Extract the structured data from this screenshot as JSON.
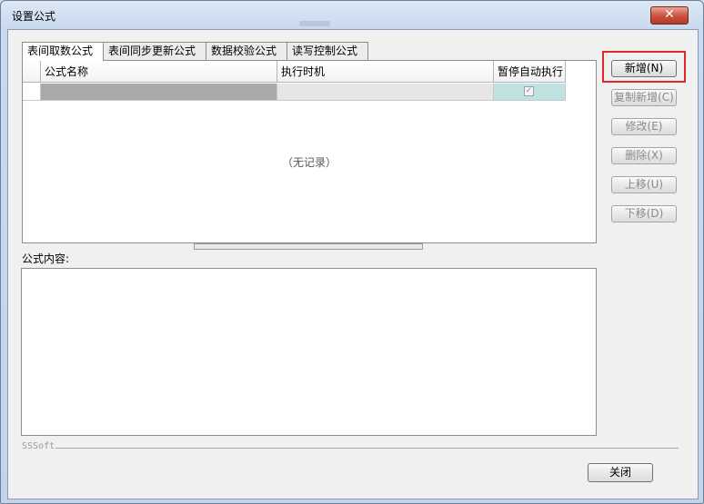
{
  "window": {
    "title": "设置公式",
    "close_glyph": "✕"
  },
  "tabs": [
    {
      "label": "表间取数公式",
      "active": true
    },
    {
      "label": "表间同步更新公式",
      "active": false
    },
    {
      "label": "数据校验公式",
      "active": false
    },
    {
      "label": "读写控制公式",
      "active": false
    }
  ],
  "grid": {
    "columns": [
      "公式名称",
      "执行时机",
      "暂停自动执行"
    ],
    "row": {
      "checkbox_checked": true,
      "checkbox_glyph": "✓"
    },
    "empty_message": "（无记录）"
  },
  "content": {
    "label": "公式内容:",
    "value": ""
  },
  "buttons": {
    "new": "新增(N)",
    "copy_new": "复制新增(C)",
    "modify": "修改(E)",
    "delete": "删除(X)",
    "move_up": "上移(U)",
    "move_down": "下移(D)",
    "close": "关闭"
  },
  "footer": {
    "brand": "SSSoft"
  },
  "colors": {
    "highlight": "#e0262a",
    "selected_row": "#a9a9a9",
    "checkbox_cell": "#bfe3e3",
    "close_button": "#c9503c"
  }
}
